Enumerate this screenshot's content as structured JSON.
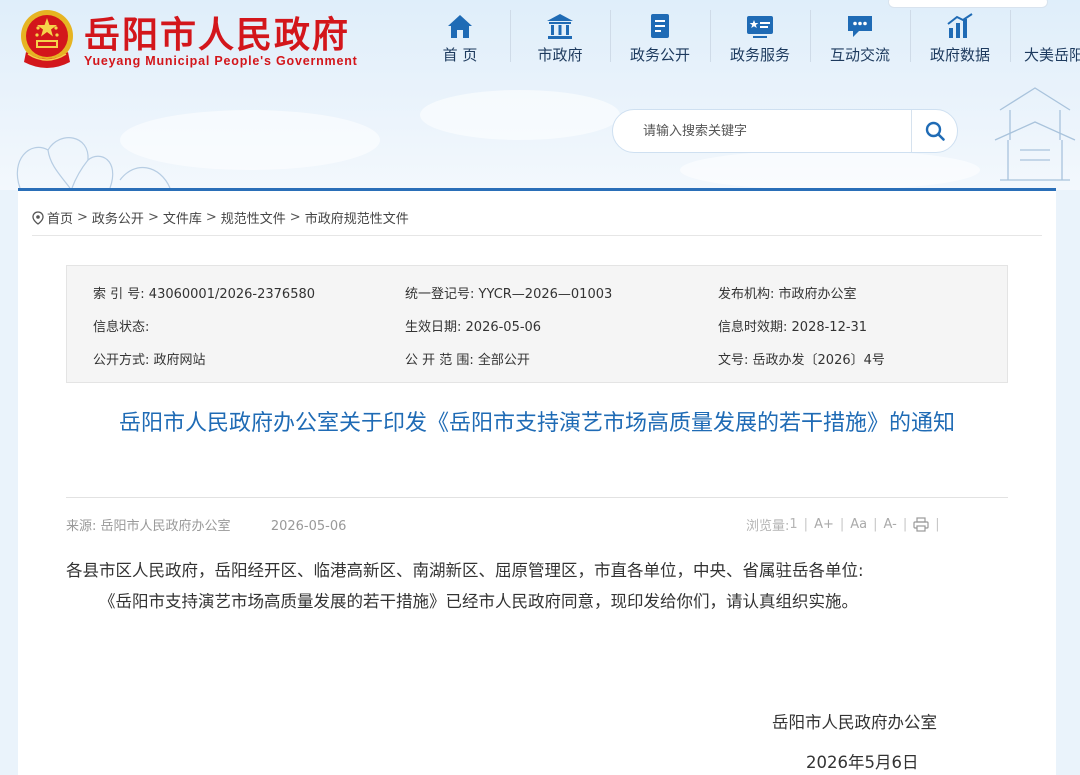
{
  "site": {
    "name_cn": "岳阳市人民政府",
    "name_en": "Yueyang Municipal People's Government"
  },
  "nav": [
    {
      "label": "首 页",
      "icon": "home-icon"
    },
    {
      "label": "市政府",
      "icon": "government-building-icon"
    },
    {
      "label": "政务公开",
      "icon": "document-icon"
    },
    {
      "label": "政务服务",
      "icon": "service-card-icon"
    },
    {
      "label": "互动交流",
      "icon": "chat-bubble-icon"
    },
    {
      "label": "政府数据",
      "icon": "bar-chart-icon"
    },
    {
      "label": "大美岳阳",
      "icon": ""
    }
  ],
  "search": {
    "placeholder": "请输入搜索关键字",
    "value": ""
  },
  "breadcrumb": [
    "首页",
    "政务公开",
    "文件库",
    "规范性文件",
    "市政府规范性文件"
  ],
  "meta": {
    "index_label": "索 引 号:",
    "index_value": "43060001/2026-2376580",
    "reg_label": "统一登记号:",
    "reg_value": "YYCR—2026—01003",
    "org_label": "发布机构:",
    "org_value": "市政府办公室",
    "status_label": "信息状态:",
    "status_value": "",
    "effective_label": "生效日期:",
    "effective_value": "2026-05-06",
    "expire_label": "信息时效期:",
    "expire_value": "2028-12-31",
    "method_label": "公开方式:",
    "method_value": "政府网站",
    "scope_label": "公 开 范 围:",
    "scope_value": "全部公开",
    "doc_label": "文号:",
    "doc_value": "岳政办发〔2026〕4号"
  },
  "article": {
    "title": "岳阳市人民政府办公室关于印发《岳阳市支持演艺市场高质量发展的若干措施》的通知",
    "source_label": "来源:",
    "source_value": "岳阳市人民政府办公室",
    "date": "2026-05-06",
    "views_label": "浏览量:",
    "views_value": "1",
    "font_increase": "A+",
    "font_reset": "Aa",
    "font_decrease": "A-",
    "paragraphs": [
      "各县市区人民政府，岳阳经开区、临港高新区、南湖新区、屈原管理区，市直各单位，中央、省属驻岳各单位:",
      "《岳阳市支持演艺市场高质量发展的若干措施》已经市人民政府同意，现印发给你们，请认真组织实施。"
    ],
    "signature_org": "岳阳市人民政府办公室",
    "signature_date": "2026年5月6日"
  },
  "colors": {
    "brand_red": "#d3161b",
    "nav_blue": "#1f6bb5",
    "title_blue": "#1f6bb5",
    "accent_line": "#2a6fb8"
  }
}
